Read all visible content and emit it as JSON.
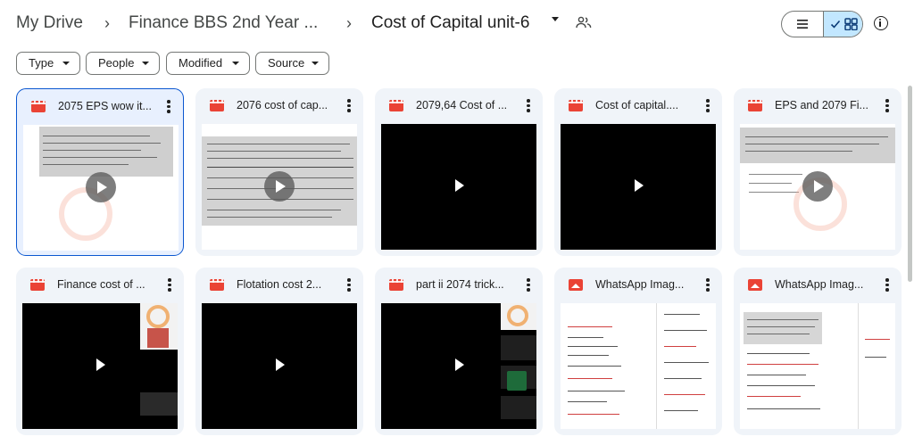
{
  "breadcrumb": {
    "root": "My Drive",
    "middle": "Finance BBS 2nd Year ...",
    "current": "Cost of Capital unit-6"
  },
  "filters": [
    {
      "label": "Type"
    },
    {
      "label": "People"
    },
    {
      "label": "Modified"
    },
    {
      "label": "Source"
    }
  ],
  "view": {
    "mode": "grid"
  },
  "files": [
    {
      "title": "2075 EPS wow it...",
      "kind": "video"
    },
    {
      "title": "2076 cost of cap...",
      "kind": "video"
    },
    {
      "title": "2079,64 Cost of ...",
      "kind": "video"
    },
    {
      "title": "Cost of capital....",
      "kind": "video"
    },
    {
      "title": "EPS and 2079 Fi...",
      "kind": "video"
    },
    {
      "title": "Finance cost of ...",
      "kind": "video"
    },
    {
      "title": "Flotation cost 2...",
      "kind": "video"
    },
    {
      "title": "part ii 2074 trick...",
      "kind": "video"
    },
    {
      "title": "WhatsApp Imag...",
      "kind": "image"
    },
    {
      "title": "WhatsApp Imag...",
      "kind": "image"
    }
  ],
  "colors": {
    "accent": "#0b57d0",
    "selected_toggle": "#c2e7ff",
    "card_bg": "#f0f4f9",
    "file_icon": "#ea4335"
  }
}
